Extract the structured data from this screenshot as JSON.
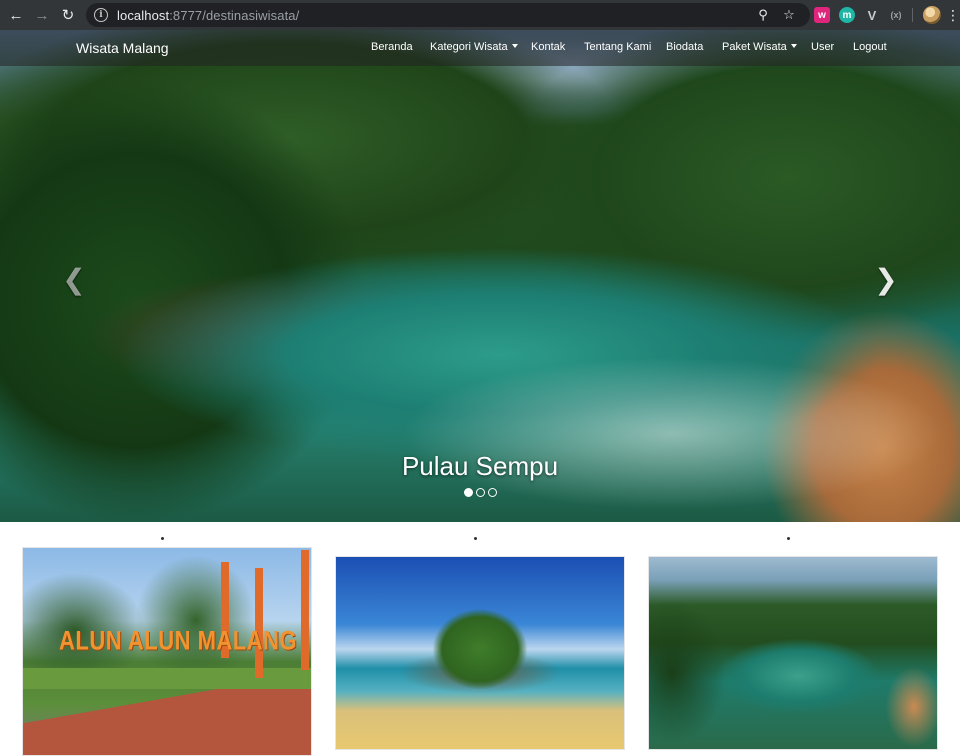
{
  "browser": {
    "url_host": "localhost",
    "url_path": ":8777/destinasiwisata/",
    "icons": [
      "back-arrow-icon",
      "forward-arrow-icon",
      "reload-icon",
      "info-icon",
      "zoom-icon",
      "star-icon",
      "menu-dots-icon"
    ],
    "extensions": [
      "w",
      "m",
      "V",
      "(x)"
    ]
  },
  "navbar": {
    "brand": "Wisata Malang",
    "links": [
      {
        "label": "Beranda"
      },
      {
        "label": "Kategori Wisata",
        "dropdown": true
      },
      {
        "label": "Kontak"
      },
      {
        "label": "Tentang Kami"
      },
      {
        "label": "Biodata"
      },
      {
        "label": "Paket Wisata",
        "dropdown": true
      },
      {
        "label": "User"
      },
      {
        "label": "Logout"
      }
    ]
  },
  "carousel": {
    "caption": "Pulau Sempu",
    "slides": 3,
    "active_slide": 1,
    "prev_icon": "chevron-left-icon",
    "next_icon": "chevron-right-icon"
  },
  "gallery": {
    "items": [
      {
        "sign_text": "ALUN ALUN MALANG"
      },
      {
        "sign_text": ""
      },
      {
        "sign_text": ""
      }
    ]
  },
  "colors": {
    "chrome_bg": "#323639",
    "omnibox_bg": "#202124",
    "navbar_bg": "rgba(34,34,34,0.55)"
  }
}
